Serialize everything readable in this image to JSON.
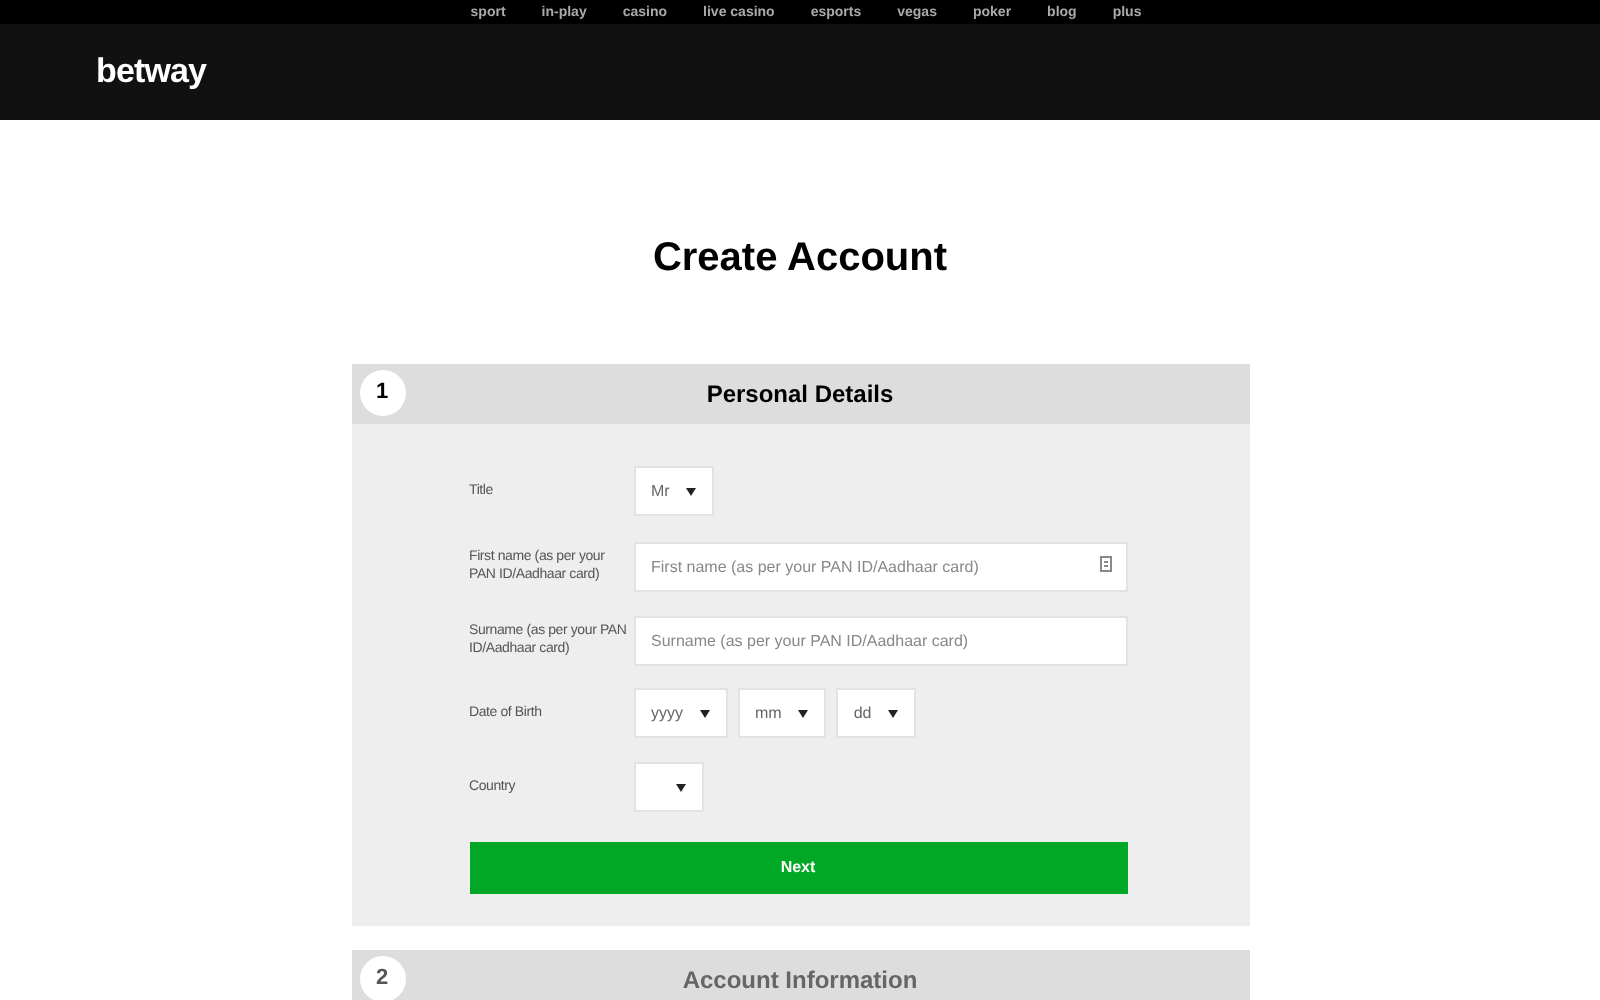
{
  "top_nav": [
    "sport",
    "in-play",
    "casino",
    "live casino",
    "esports",
    "vegas",
    "poker",
    "blog",
    "plus"
  ],
  "logo": "betway",
  "page_title": "Create Account",
  "steps": [
    {
      "number": "1",
      "title": "Personal Details",
      "expanded": true,
      "fields": [
        {
          "kind": "select",
          "label": "Title",
          "selects": [
            {
              "value": "Mr"
            }
          ]
        },
        {
          "kind": "text",
          "label": "First name (as per your PAN ID/Aadhaar card)",
          "placeholder": "First name (as per your PAN ID/Aadhaar card)",
          "has_icon": true
        },
        {
          "kind": "text",
          "label": "Surname (as per your PAN ID/Aadhaar card)",
          "placeholder": "Surname (as per your PAN ID/Aadhaar card)",
          "has_icon": false
        },
        {
          "kind": "select",
          "label": "Date of Birth",
          "selects": [
            {
              "value": "yyyy"
            },
            {
              "value": "mm"
            },
            {
              "value": "dd"
            }
          ]
        },
        {
          "kind": "empty_select",
          "label": "Country"
        }
      ],
      "button": "Next"
    },
    {
      "number": "2",
      "title": "Account Information",
      "expanded": false
    }
  ]
}
